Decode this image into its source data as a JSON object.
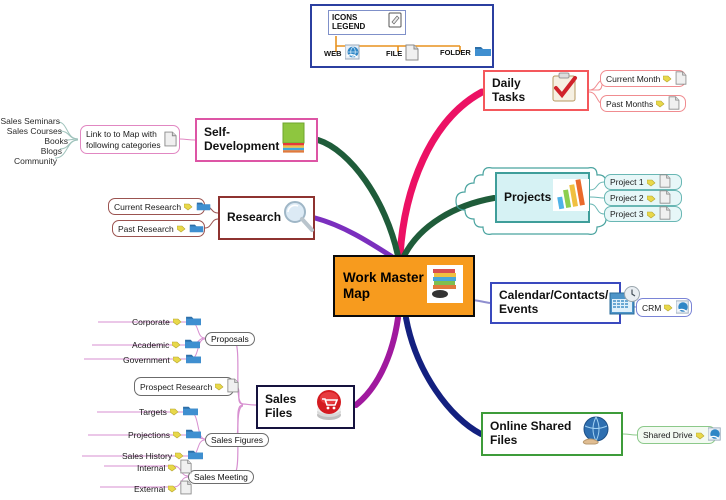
{
  "legend": {
    "title": "ICONS\nLEGEND",
    "title_line1": "ICONS",
    "title_line2": "LEGEND",
    "head_icon": "page-edit-icon",
    "items": [
      {
        "label": "WEB",
        "icon": "web-globe-icon"
      },
      {
        "label": "FILE",
        "icon": "file-document-icon"
      },
      {
        "label": "FOLDER",
        "icon": "folder-icon"
      }
    ],
    "border_color": "#2B3FA0",
    "connector_color": "#E8921F"
  },
  "central": {
    "title_line1": "Work Master",
    "title_line2": "Map",
    "icon": "book-stack-icon",
    "fill": "#F79B1E",
    "border": "#0A0A0A"
  },
  "branches": [
    {
      "id": "daily-tasks",
      "label": "Daily Tasks",
      "icon": "clipboard-check-icon",
      "border_color": "#F4585C",
      "wire_color": "#EC1164",
      "children": [
        {
          "label": "Current Month",
          "icon": "file-document-icon",
          "tag": "tag-icon"
        },
        {
          "label": "Past Months",
          "icon": "file-document-icon",
          "tag": "tag-icon"
        }
      ]
    },
    {
      "id": "projects",
      "label": "Projects",
      "icon": "bar-chart-icon",
      "border_color": "#3F9E9A",
      "fill": "#D6F2F4",
      "wire_color": "#1F5C3A",
      "children": [
        {
          "label": "Project 1",
          "icon": "file-document-icon",
          "tag": "tag-icon"
        },
        {
          "label": "Project 2",
          "icon": "file-document-icon",
          "tag": "tag-icon"
        },
        {
          "label": "Project 3",
          "icon": "file-document-icon",
          "tag": "tag-icon"
        }
      ]
    },
    {
      "id": "calendar-contacts-events",
      "label_line1": "Calendar/Contacts/",
      "label_line2": "Events",
      "icon": "calendar-clock-icon",
      "border_color": "#3A49BE",
      "wire_color": "#8E8ECF",
      "children": [
        {
          "label": "CRM",
          "icon": "web-globe-icon",
          "tag": "tag-icon"
        }
      ]
    },
    {
      "id": "online-shared-files",
      "label": "Online Shared Files",
      "icon": "globe-hand-icon",
      "border_color": "#3E9C3A",
      "wire_color": "#13207F",
      "children": [
        {
          "label": "Shared Drive",
          "icon": "web-globe-icon",
          "tag": "tag-icon"
        }
      ]
    },
    {
      "id": "self-development",
      "label": "Self-Development",
      "icon": "green-books-icon",
      "border_color": "#DD55A5",
      "wire_color": "#1F5C3A",
      "children": [
        {
          "label_line1": "Link to to Map with",
          "label_line2": "following categories",
          "icon": "file-document-icon",
          "leaves": [
            "Sales Seminars",
            "Sales Courses",
            "Books",
            "Blogs",
            "Community"
          ]
        }
      ]
    },
    {
      "id": "research",
      "label": "Research",
      "icon": "magnifier-icon",
      "border_color": "#8E3330",
      "wire_color": "#7B2FBE",
      "children": [
        {
          "label": "Current Research",
          "icon": "folder-icon",
          "tag": "tag-icon"
        },
        {
          "label": "Past Research",
          "icon": "folder-icon",
          "tag": "tag-icon"
        }
      ]
    },
    {
      "id": "sales-files",
      "label": "Sales Files",
      "icon": "red-cart-button-icon",
      "border_color": "#15123E",
      "wire_color": "#A0199E",
      "groups": [
        {
          "name": "Proposals",
          "items": [
            {
              "label": "Corporate",
              "icon": "folder-icon",
              "tag": "tag-icon"
            },
            {
              "label": "Academic",
              "icon": "folder-icon",
              "tag": "tag-icon"
            },
            {
              "label": "Government",
              "icon": "folder-icon",
              "tag": "tag-icon"
            }
          ]
        },
        {
          "name": "Sales Figures",
          "items": [
            {
              "label": "Targets",
              "icon": "folder-icon",
              "tag": "tag-icon"
            },
            {
              "label": "Projections",
              "icon": "folder-icon",
              "tag": "tag-icon"
            },
            {
              "label": "Sales History",
              "icon": "folder-icon",
              "tag": "tag-icon"
            }
          ]
        },
        {
          "name": "Sales Meeting",
          "items": [
            {
              "label": "Internal",
              "icon": "file-document-icon",
              "tag": "tag-icon"
            },
            {
              "label": "External",
              "icon": "file-document-icon",
              "tag": "tag-icon"
            }
          ]
        }
      ],
      "standalone": [
        {
          "label": "Prospect Research",
          "icon": "file-document-icon",
          "tag": "tag-icon"
        }
      ]
    }
  ]
}
